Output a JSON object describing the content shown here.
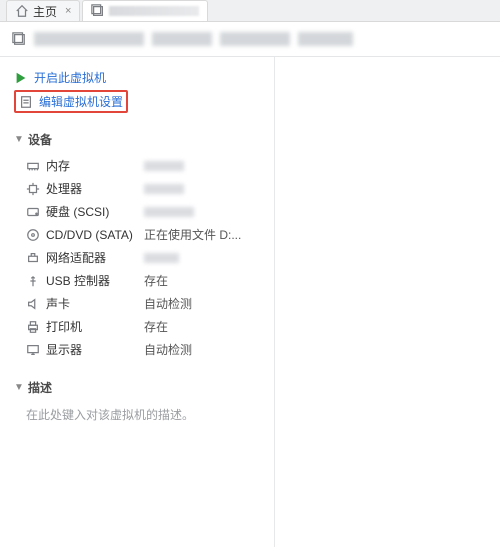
{
  "tabs": {
    "home": "主页",
    "vm_name_blurred": true
  },
  "title_blurred": true,
  "actions": {
    "power_on": "开启此虚拟机",
    "edit_settings": "编辑虚拟机设置"
  },
  "sections": {
    "devices_header": "设备",
    "description_header": "描述",
    "description_placeholder": "在此处键入对该虚拟机的描述。"
  },
  "devices": [
    {
      "id": "memory",
      "label": "内存",
      "value_blurred": true
    },
    {
      "id": "cpu",
      "label": "处理器",
      "value_blurred": true
    },
    {
      "id": "hdd",
      "label": "硬盘 (SCSI)",
      "value_blurred": true
    },
    {
      "id": "cd",
      "label": "CD/DVD (SATA)",
      "value": "正在使用文件 D:..."
    },
    {
      "id": "net",
      "label": "网络适配器",
      "value_blurred": true
    },
    {
      "id": "usb",
      "label": "USB 控制器",
      "value": "存在"
    },
    {
      "id": "sound",
      "label": "声卡",
      "value": "自动检测"
    },
    {
      "id": "printer",
      "label": "打印机",
      "value": "存在"
    },
    {
      "id": "display",
      "label": "显示器",
      "value": "自动检测"
    }
  ]
}
